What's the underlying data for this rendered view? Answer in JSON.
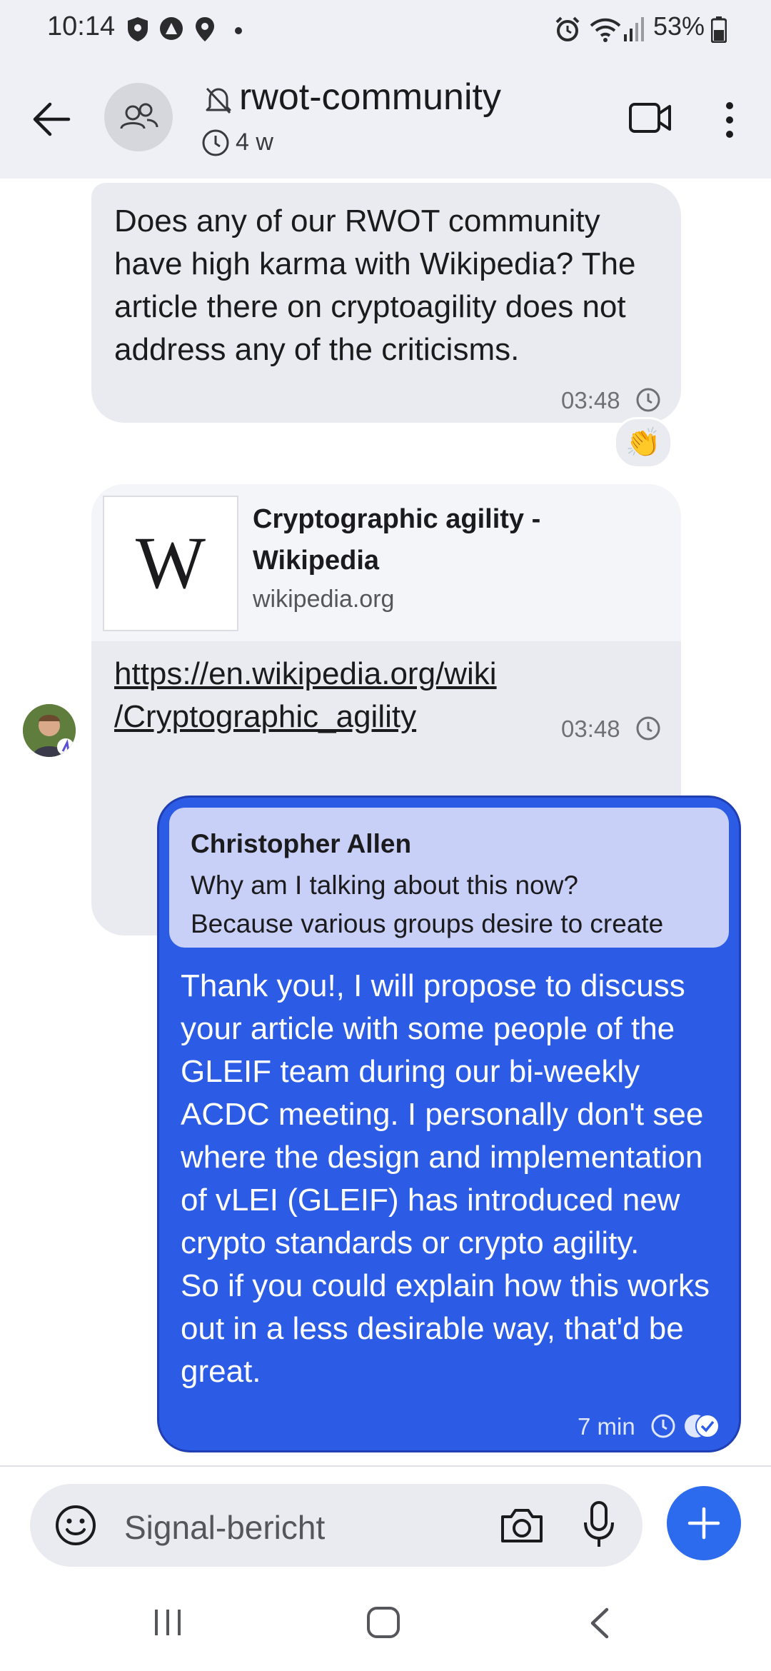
{
  "status_bar": {
    "time": "10:14",
    "battery": "53%",
    "icons": [
      "shield-icon",
      "assistant-icon",
      "location-icon",
      "dot-icon",
      "alarm-icon",
      "wifi-icon",
      "signal-icon",
      "battery-icon"
    ]
  },
  "header": {
    "title": "rwot-community",
    "disappearing_timer": "4 w",
    "muted": true
  },
  "messages": [
    {
      "text": "Does any of our RWOT community have high karma with Wikipedia? The article there on cryptoagility does not address any of the criticisms.",
      "time": "03:48",
      "reaction": "👏"
    },
    {
      "link_preview": {
        "title": "Cryptographic agility - Wikipedia",
        "domain": "wikipedia.org",
        "thumbnail_letter": "W"
      },
      "url_line1": "https://en.wikipedia.org/wiki",
      "url_line2": "/Cryptographic_agility",
      "time": "03:48"
    },
    {
      "quote": {
        "author": "Christopher Allen",
        "line1": "Why am I talking about this now?",
        "line2": "Because various groups desire to create"
      },
      "text": "Thank you!, I will propose to discuss your article with some people of the GLEIF team during our bi-weekly ACDC meeting. I personally don't see where the  design and implementation of vLEI (GLEIF) has introduced new crypto standards or crypto agility.\nSo if you could explain how this works out in a less desirable way, that'd be great.",
      "time": "7 min"
    }
  ],
  "composer": {
    "placeholder": "Signal-bericht"
  },
  "colors": {
    "accent": "#2c6bed",
    "outgoing_bubble": "#2c5ce6",
    "quote_bg": "#c8d0f8",
    "incoming_bubble": "#e9ebf0",
    "header_bg": "#eef0f5"
  }
}
